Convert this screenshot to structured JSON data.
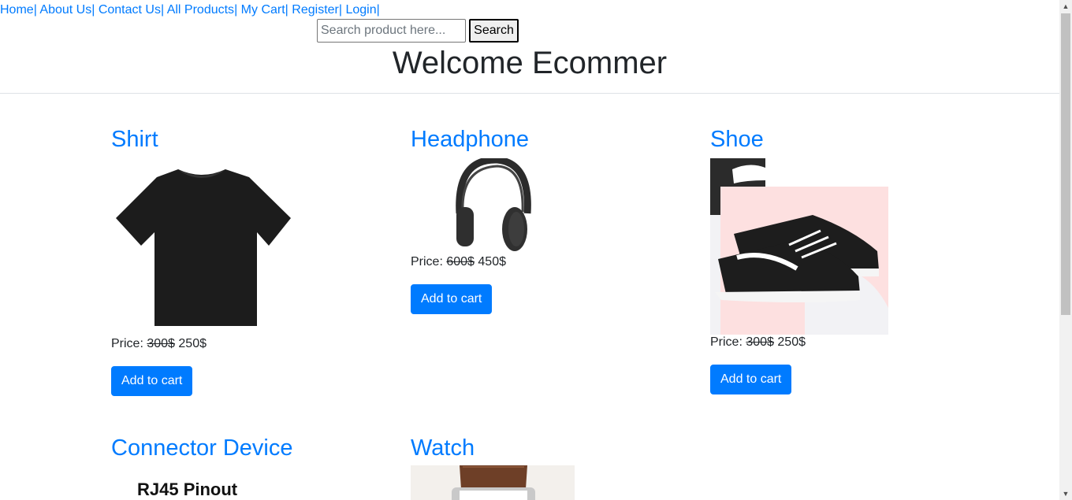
{
  "nav": {
    "items": [
      {
        "label": "Home"
      },
      {
        "label": "About Us"
      },
      {
        "label": "Contact Us"
      },
      {
        "label": "All Products"
      },
      {
        "label": "My Cart"
      },
      {
        "label": "Register"
      },
      {
        "label": "Login"
      }
    ],
    "separator": "| "
  },
  "search": {
    "placeholder": "Search product here...",
    "value": "",
    "button_label": "Search"
  },
  "page": {
    "title": "Welcome Ecommer"
  },
  "products": [
    {
      "name": "Shirt",
      "price_label": "Price:",
      "old_price": "300$",
      "new_price": "250$",
      "button_label": "Add to cart"
    },
    {
      "name": "Headphone",
      "price_label": "Price:",
      "old_price": "600$",
      "new_price": "450$",
      "button_label": "Add to cart"
    },
    {
      "name": "Shoe",
      "price_label": "Price:",
      "old_price": "300$",
      "new_price": "250$",
      "button_label": "Add to cart"
    },
    {
      "name": "Connector Device",
      "image_text": "RJ45 Pinout"
    },
    {
      "name": "Watch"
    }
  ],
  "colors": {
    "link": "#007bff",
    "button": "#007bff",
    "text": "#212529"
  },
  "icons": [
    "tshirt-image",
    "headphone-image",
    "shoe-image",
    "rj45-image",
    "watch-image",
    "scroll-up-icon",
    "scroll-down-icon"
  ]
}
